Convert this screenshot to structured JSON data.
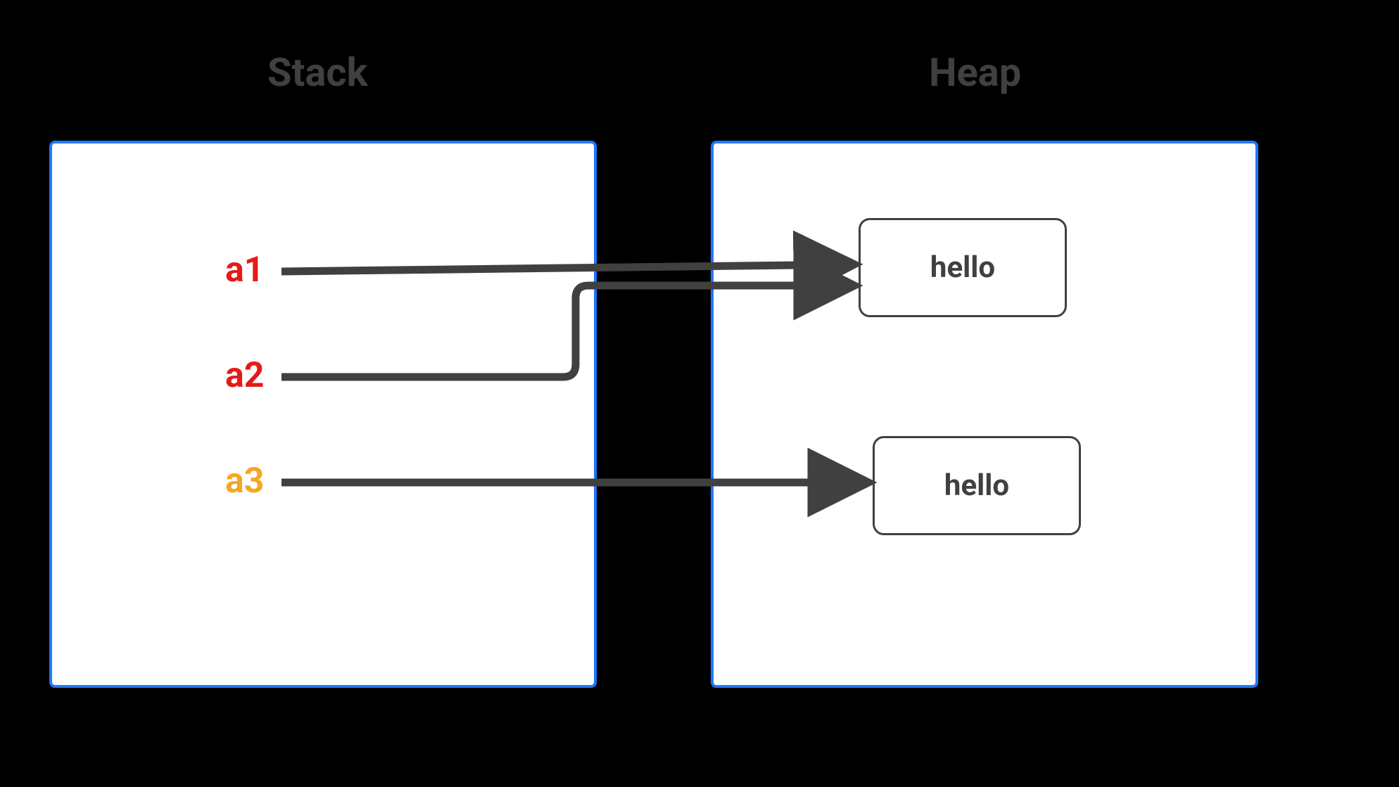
{
  "titles": {
    "stack": "Stack",
    "heap": "Heap"
  },
  "stack": {
    "vars": {
      "a1": "a1",
      "a2": "a2",
      "a3": "a3"
    }
  },
  "heap": {
    "obj1": "hello",
    "obj2": "hello"
  },
  "colors": {
    "border": "#2077ff",
    "arrow": "#404040",
    "a1": "#e41b17",
    "a2": "#e41b17",
    "a3": "#f5a623"
  },
  "diagram": {
    "description": "Stack variables a1 and a2 both reference the same heap object containing 'hello'. Stack variable a3 references a separate heap object also containing 'hello'.",
    "references": [
      {
        "from": "a1",
        "to": "obj1"
      },
      {
        "from": "a2",
        "to": "obj1"
      },
      {
        "from": "a3",
        "to": "obj2"
      }
    ]
  }
}
